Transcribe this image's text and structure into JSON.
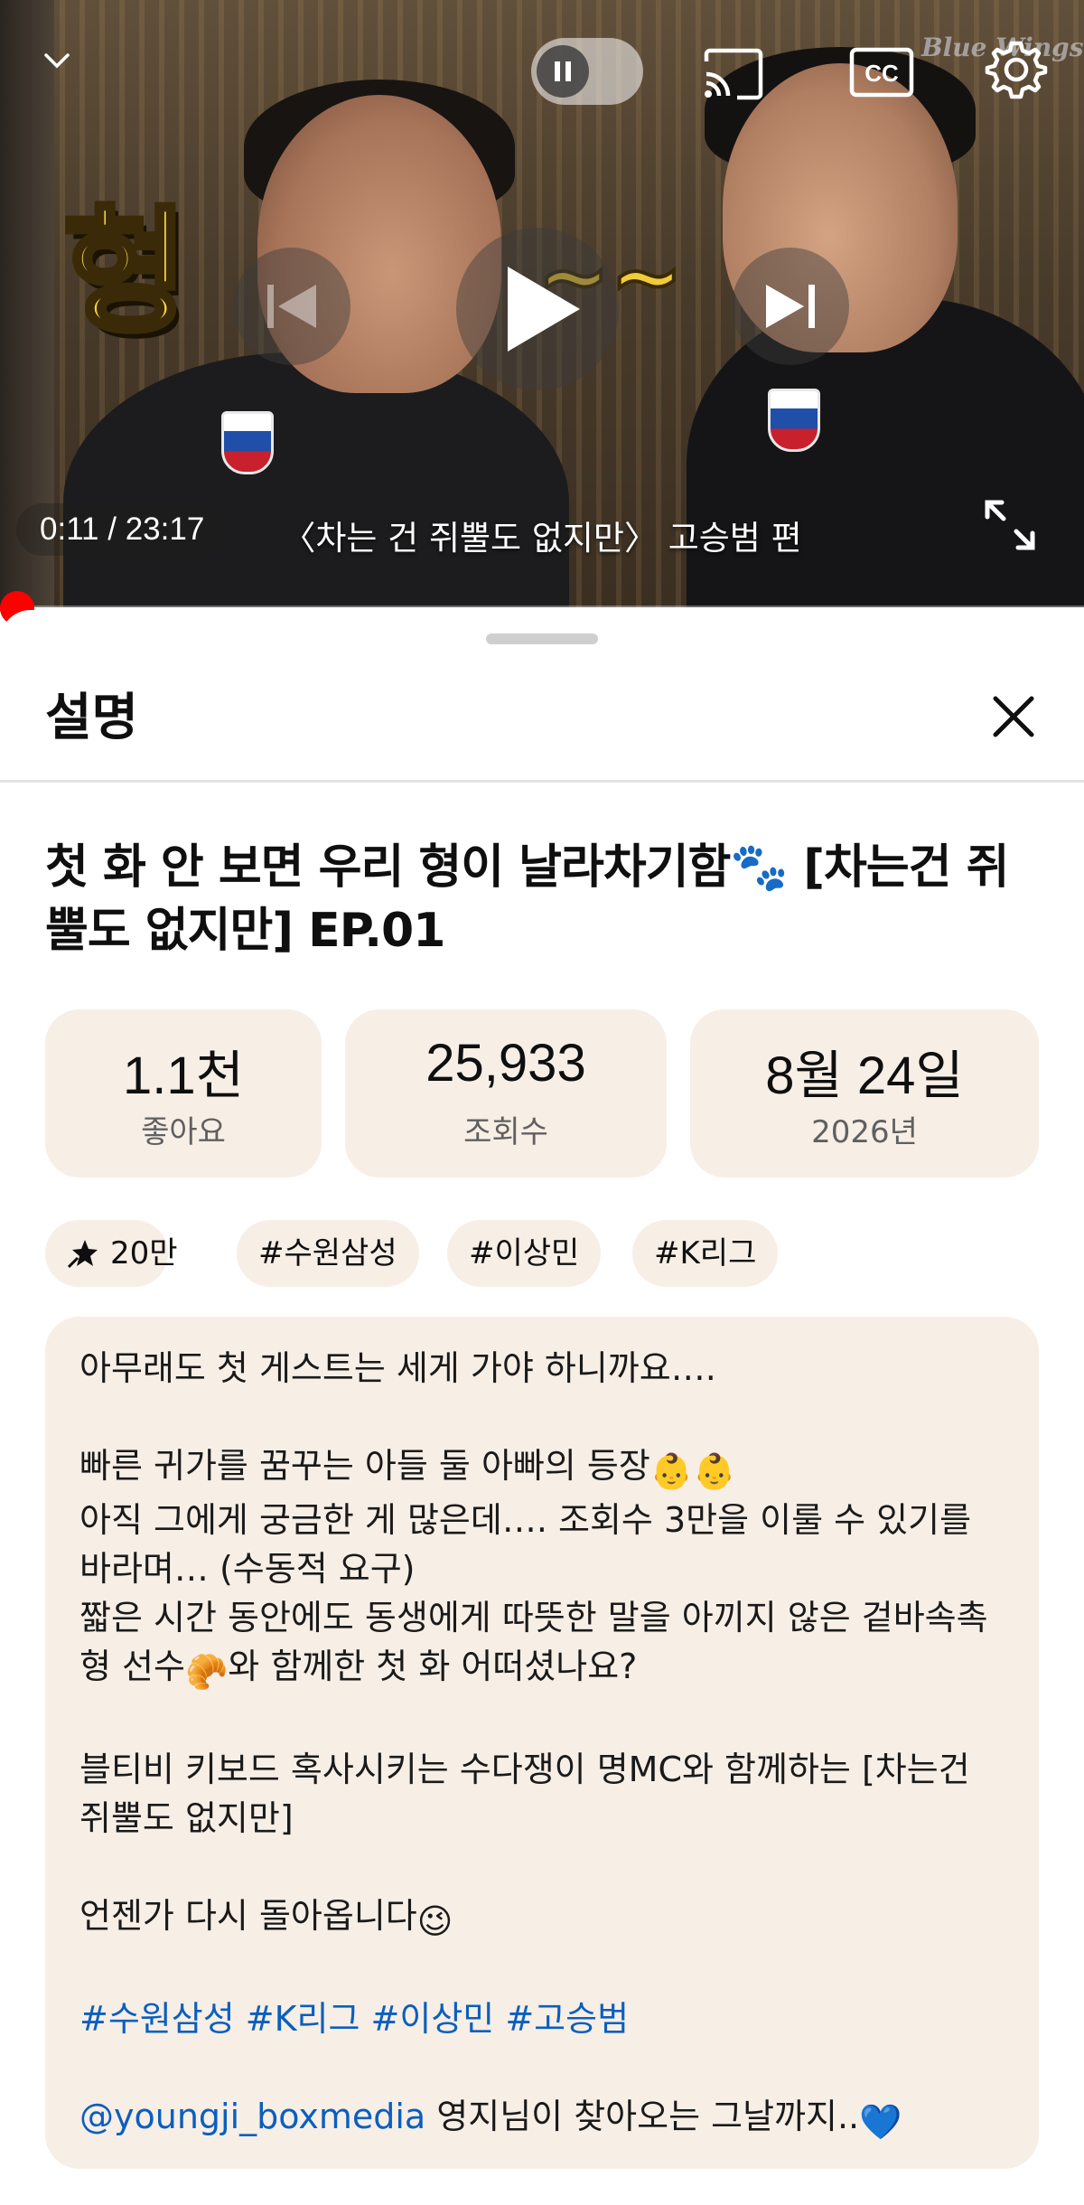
{
  "player": {
    "overlay_text": "형",
    "overlay_tilde": "~~",
    "time": "0:11 / 23:17",
    "caption": "〈차는 건 쥐뿔도 없지만〉 고승범 편",
    "brand_mark": "Blue Wings",
    "progress": 0.008,
    "icons": [
      "chevron-down-icon",
      "pause-icon",
      "cast-icon",
      "closed-captions-icon",
      "gear-icon",
      "previous-icon",
      "play-icon",
      "next-icon",
      "fullscreen-icon"
    ]
  },
  "sheet": {
    "title": "설명"
  },
  "video": {
    "title": "첫 화 안 보면 우리 형이 날라차기함🐾 [차는건 쥐뿔도 없지만] EP.01"
  },
  "stats": [
    {
      "value": "1.1천",
      "label": "좋아요"
    },
    {
      "value": "25,933",
      "label": "조회수"
    },
    {
      "value": "8월 24일",
      "label": "2026년"
    }
  ],
  "chips": {
    "promo": "20만",
    "tag1": "#수원삼성",
    "tag2": "#이상민",
    "tag3": "#K리그"
  },
  "description": {
    "line1": "아무래도 첫 게스트는 세게 가야 하니까요….",
    "line2": "빠른 귀가를 꿈꾸는 아들 둘 아빠의 등장",
    "line3": "아직 그에게 궁금한 게 많은데…. 조회수 3만을 이룰 수 있기를 바라며… (수동적 요구)",
    "line4": "짧은 시간 동안에도 동생에게 따뜻한 말을 아끼지 않은 겉바속촉형 선수",
    "line4b": "와 함께한 첫 화 어떠셨나요?",
    "line5": "블티비 키보드 혹사시키는 수다쟁이 명MC와 함께하는 [차는건 쥐뿔도 없지만]",
    "line6": "언젠가 다시 돌아옵니다",
    "hashtags": "#수원삼성 #K리그 #이상민 #고승범",
    "mention": "@youngji_boxmedia",
    "mention_tail": " 영지님이 찾아오는 그날까지..",
    "emoji_baby": "👶",
    "emoji_croissant": "🥐",
    "emoji_wink": "😉",
    "emoji_heart": "💙"
  },
  "colors": {
    "accent_red": "#ff0000",
    "card_bg": "#f7eee6",
    "link": "#0a5fbf"
  }
}
